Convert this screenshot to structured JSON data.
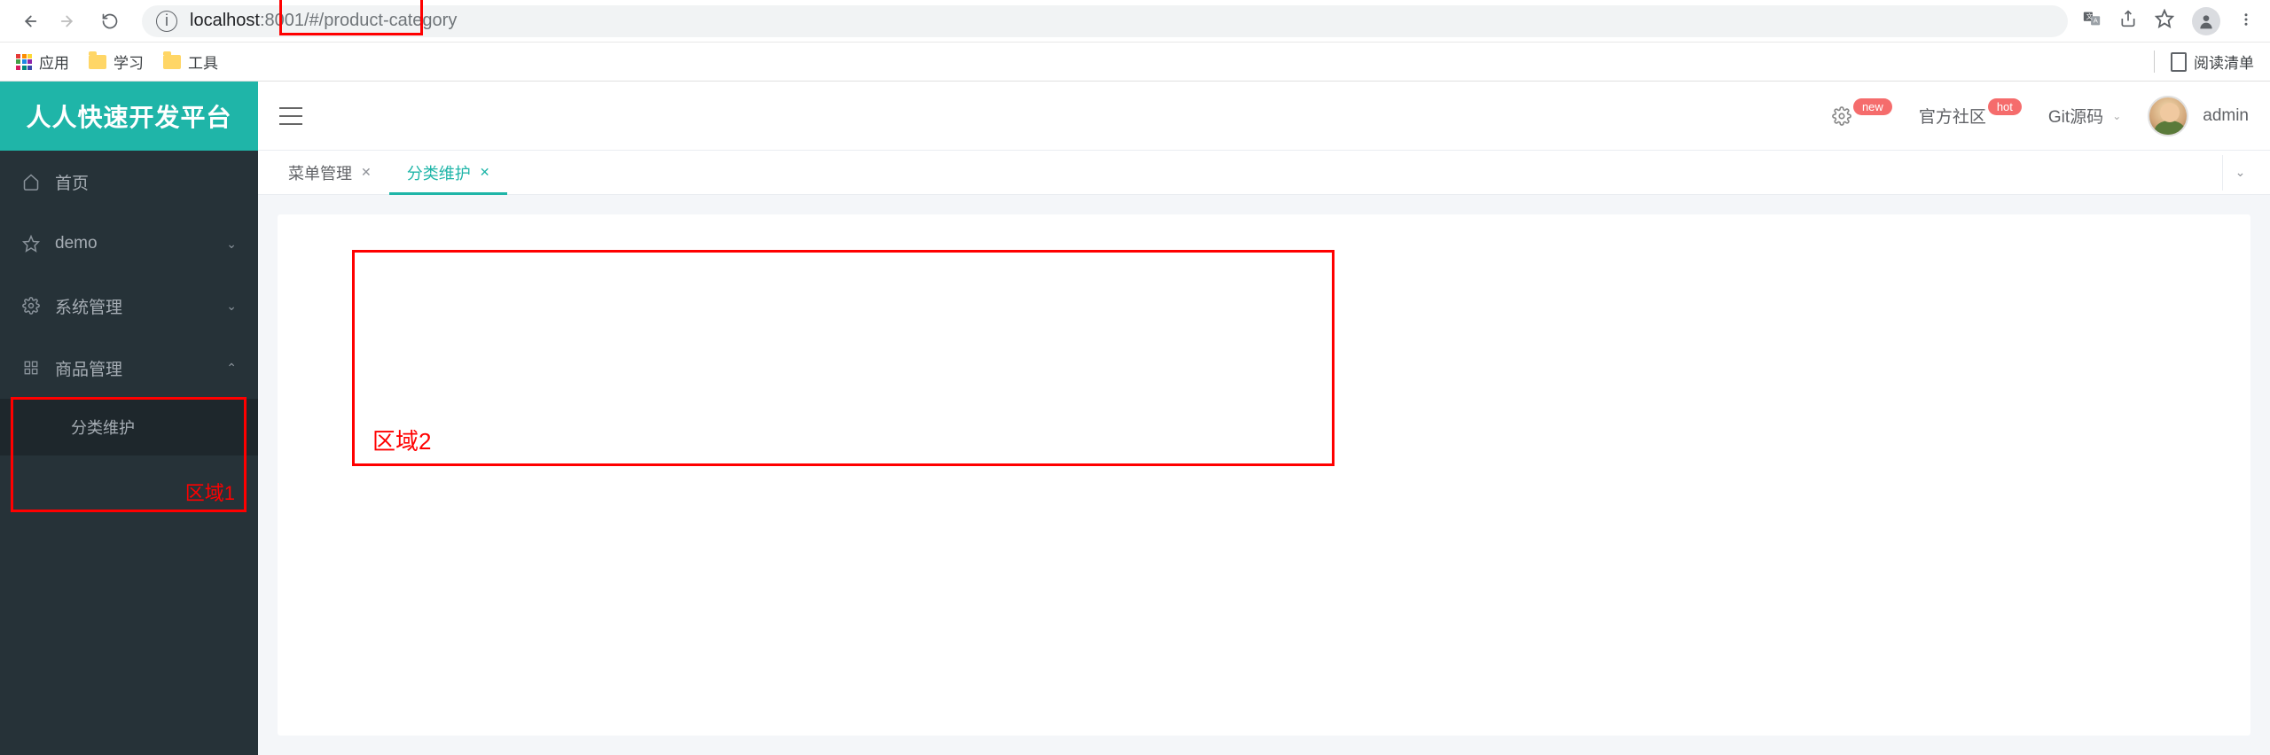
{
  "browser": {
    "url_host": "localhost",
    "url_port": ":8001",
    "url_path": "/#/product-category",
    "bookmarks": {
      "apps_label": "应用",
      "folder1_label": "学习",
      "folder2_label": "工具",
      "reading_list_label": "阅读清单"
    }
  },
  "sidebar": {
    "brand": "人人快速开发平台",
    "items": [
      {
        "icon": "home",
        "label": "首页"
      },
      {
        "icon": "star",
        "label": "demo"
      },
      {
        "icon": "gear",
        "label": "系统管理"
      },
      {
        "icon": "grid",
        "label": "商品管理"
      }
    ],
    "submenu": {
      "label": "分类维护"
    }
  },
  "header": {
    "settings_badge": "new",
    "community_label": "官方社区",
    "community_badge": "hot",
    "git_label": "Git源码",
    "user_name": "admin"
  },
  "tabs": [
    {
      "label": "菜单管理",
      "active": false
    },
    {
      "label": "分类维护",
      "active": true
    }
  ],
  "annotations": {
    "area1": "区域1",
    "area2": "区域2"
  }
}
